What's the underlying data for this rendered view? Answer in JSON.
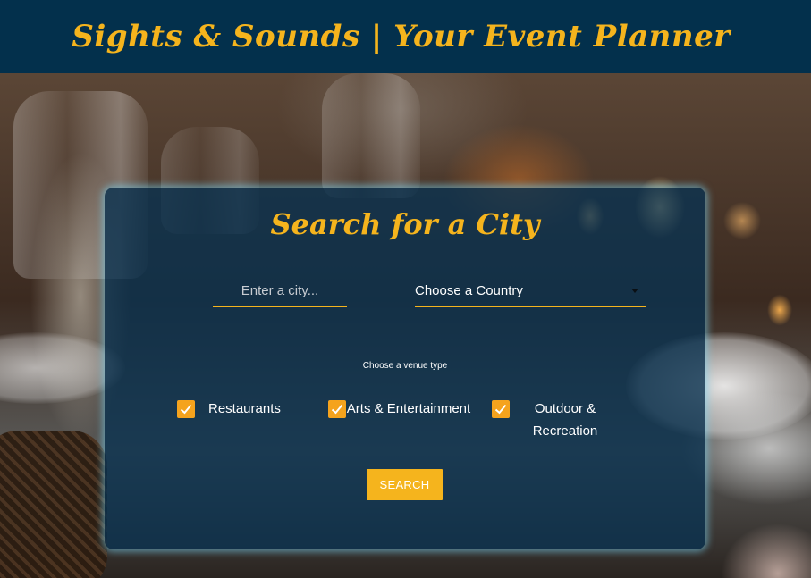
{
  "header": {
    "title": "Sights & Sounds | Your Event Planner"
  },
  "search": {
    "title": "Search for a City",
    "city_placeholder": "Enter a city...",
    "country_selected": "Choose a Country",
    "venue_label": "Choose a venue type",
    "venue_options": [
      {
        "label": "Restaurants",
        "checked": true
      },
      {
        "label": "Arts & Entertainment",
        "checked": true
      },
      {
        "label": "Outdoor & Recreation",
        "checked": true
      }
    ],
    "button_label": "SEARCH"
  },
  "colors": {
    "header_bg": "#03304c",
    "accent": "#f5b41d",
    "checkbox": "#f5a31d",
    "card_bg": "#0a3250",
    "card_glow": "#78d2f0"
  }
}
